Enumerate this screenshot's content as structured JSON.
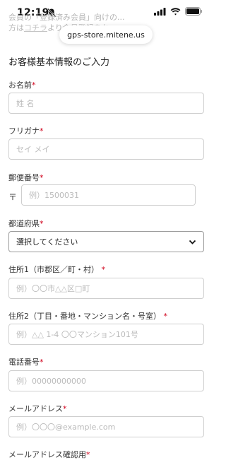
{
  "status_bar": {
    "time": "12:19"
  },
  "behind_text": {
    "line1": "会員の「登録済み会員」向けの...",
    "line2_prefix": "方は",
    "line2_link": "コチラ",
    "line2_suffix": "より会員登録をお..."
  },
  "browser": {
    "url": "gps-store.mitene.us"
  },
  "form": {
    "section_title": "お客様基本情報のご入力",
    "required_mark": "*",
    "zip_prefix": "〒",
    "fields": [
      {
        "label": "お名前",
        "placeholder": "姓 名"
      },
      {
        "label": "フリガナ",
        "placeholder": "セイ メイ"
      },
      {
        "label": "郵便番号",
        "placeholder": "例）1500031"
      },
      {
        "label": "都道府県",
        "value": "選択してください"
      },
      {
        "label": "住所1（市郡区／町・村）",
        "placeholder": "例）〇〇市△△区□町"
      },
      {
        "label": "住所2（丁目・番地・マンション名・号室）",
        "placeholder": "例）△△ 1-4 〇〇マンション101号"
      },
      {
        "label": "電話番号",
        "placeholder": "例）00000000000"
      },
      {
        "label": "メールアドレス",
        "placeholder": "例）〇〇〇@example.com"
      },
      {
        "label": "メールアドレス確認用"
      }
    ]
  }
}
